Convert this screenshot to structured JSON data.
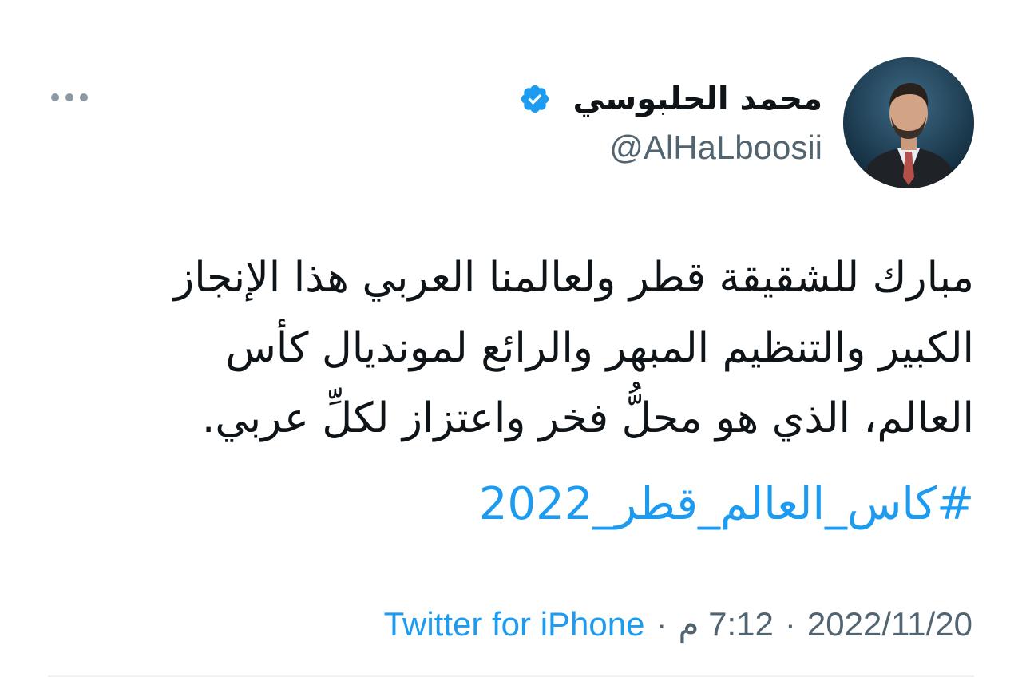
{
  "author": {
    "name": "محمد الحلبوسي",
    "handle": "@AlHaLboosii",
    "verified": true
  },
  "tweet": {
    "lines": [
      "مبارك للشقيقة قطر ولعالمنا العربي هذا الإنجاز",
      "الكبير والتنظيم المبهر والرائع لمونديال كأس",
      "العالم، الذي هو محلُّ فخر واعتزاز  لكلِّ عربي."
    ],
    "hashtag": "#كاس_العالم_قطر_2022"
  },
  "meta": {
    "date": "2022/11/20",
    "time": "7:12 م",
    "source": "Twitter for iPhone",
    "separator": "·"
  },
  "colors": {
    "link": "#1d9bf0",
    "text": "#0f1419",
    "secondary": "#536471"
  },
  "icons": {
    "verified": "verified-badge-icon",
    "more": "more-dots-icon"
  }
}
